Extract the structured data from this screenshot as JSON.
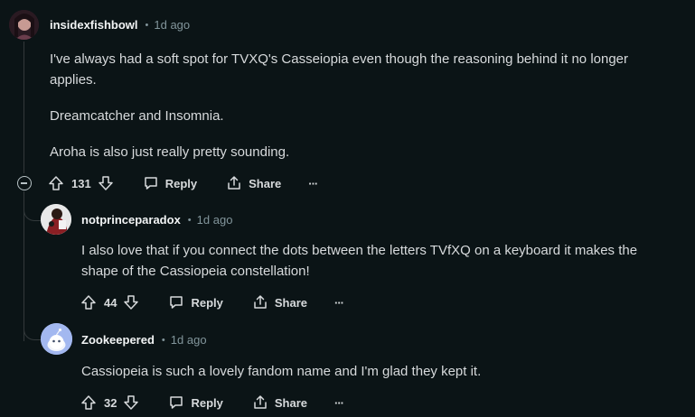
{
  "comments": [
    {
      "username": "insidexfishbowl",
      "separator": "•",
      "age": "1d ago",
      "paragraphs": [
        "I've always had a soft spot for TVXQ's Casseiopia even though the reasoning behind it no longer applies.",
        "Dreamcatcher and Insomnia.",
        "Aroha is also just really pretty sounding."
      ],
      "votes": "131",
      "reply_label": "Reply",
      "share_label": "Share",
      "more_label": "···"
    },
    {
      "username": "notprinceparadox",
      "separator": "•",
      "age": "1d ago",
      "paragraphs": [
        "I also love that if you connect the dots between the letters TVfXQ on a keyboard it makes the shape of the Cassiopeia constellation!"
      ],
      "votes": "44",
      "reply_label": "Reply",
      "share_label": "Share",
      "more_label": "···"
    },
    {
      "username": "Zookeepered",
      "separator": "•",
      "age": "1d ago",
      "paragraphs": [
        "Cassiopeia is such a lovely fandom name and I'm glad they kept it."
      ],
      "votes": "32",
      "reply_label": "Reply",
      "share_label": "Share",
      "more_label": "···"
    }
  ],
  "colors": {
    "background": "#0b1416",
    "text": "#d7dadc",
    "muted": "#82959b",
    "thread_line": "#33393b",
    "avatar_default": "#a3b8f0"
  }
}
